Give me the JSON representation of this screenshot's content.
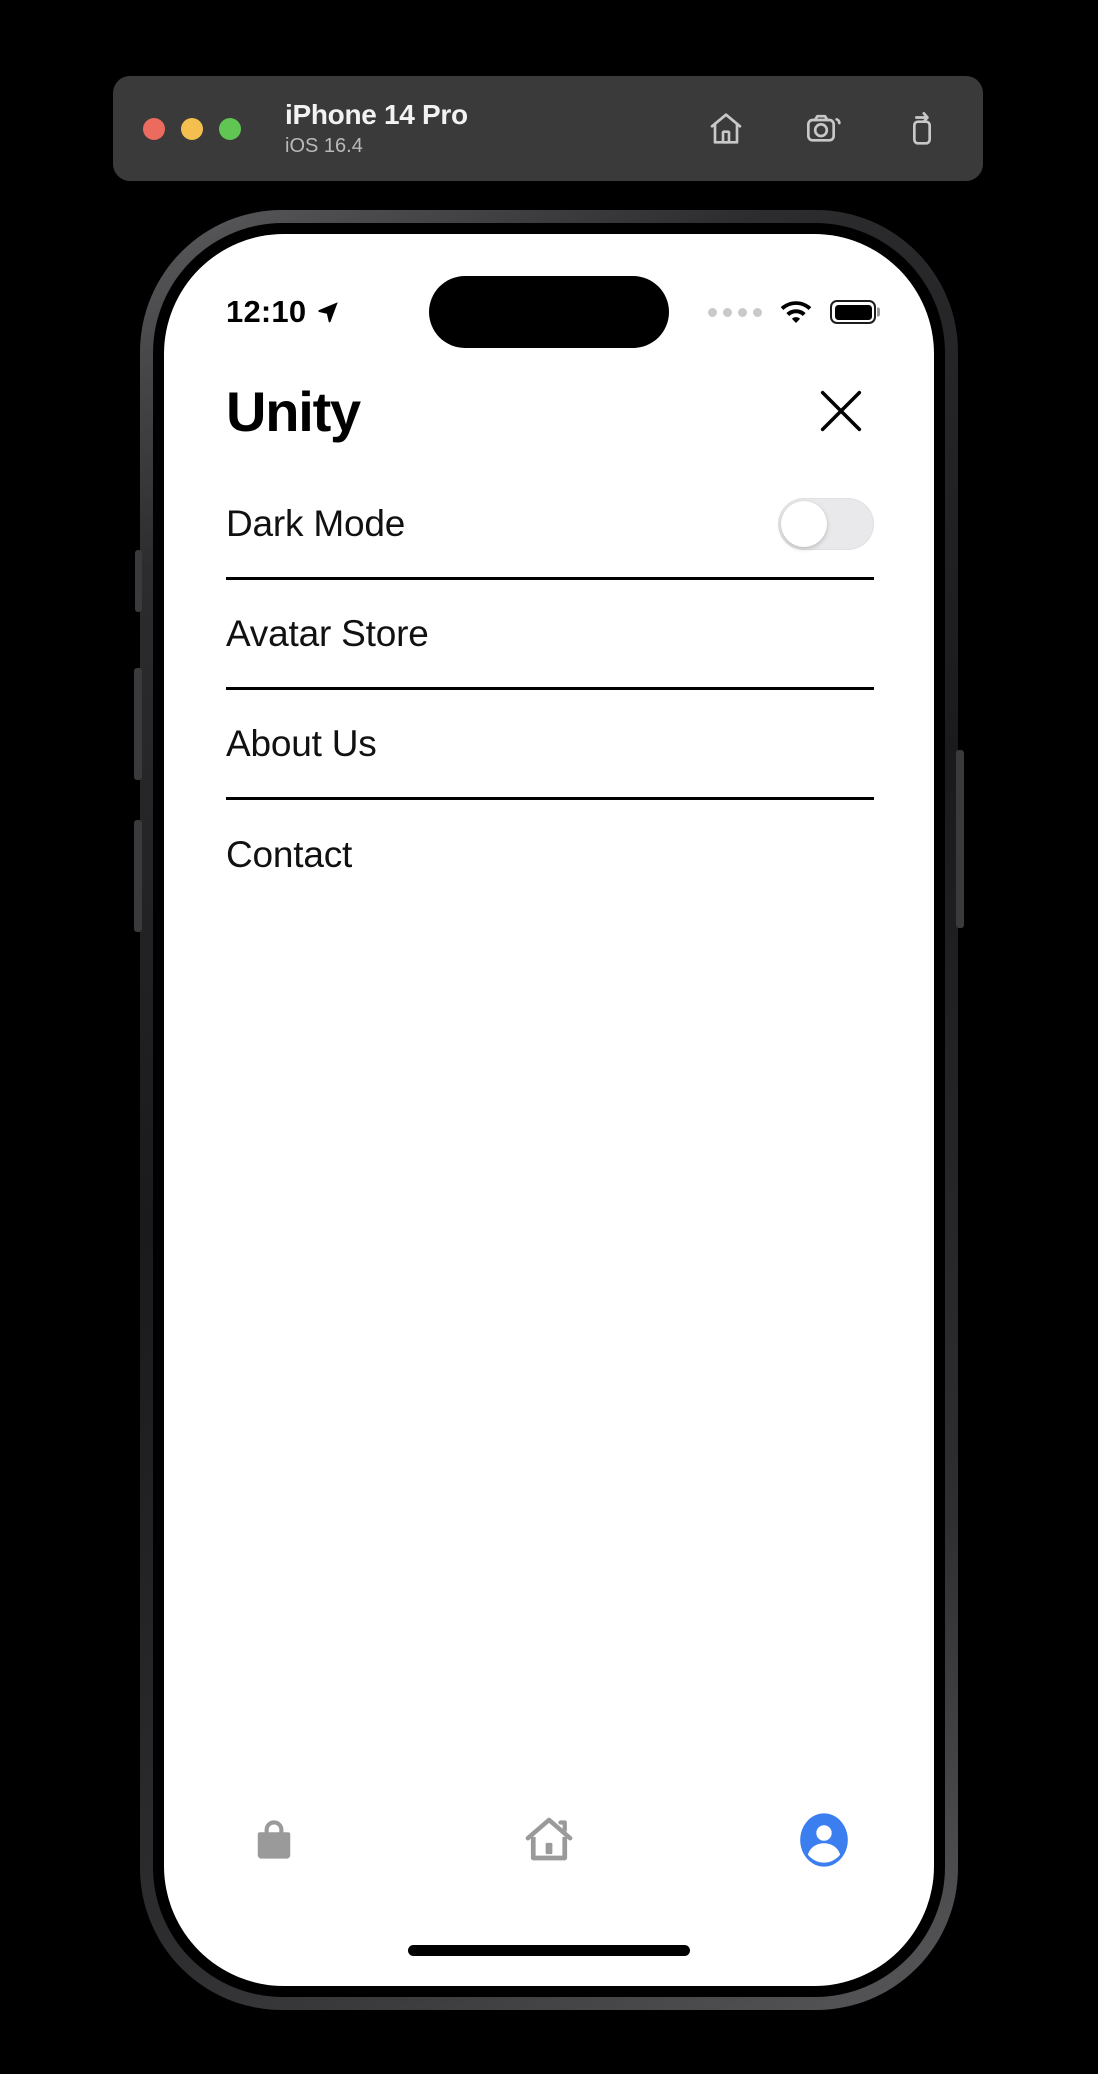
{
  "simulator": {
    "window_title": "iPhone 14 Pro",
    "os_version": "iOS 16.4",
    "traffic_lights": [
      {
        "name": "close",
        "color": "#ed6a5e"
      },
      {
        "name": "minimize",
        "color": "#f5bf4f"
      },
      {
        "name": "maximize",
        "color": "#61c554"
      }
    ],
    "actions": [
      {
        "name": "home-icon",
        "label": "Home"
      },
      {
        "name": "screenshot-icon",
        "label": "Screenshot"
      },
      {
        "name": "rotate-device-icon",
        "label": "Rotate"
      }
    ]
  },
  "status_bar": {
    "time": "12:10",
    "location_icon": "location-arrow-icon",
    "cellular_dots": 4,
    "wifi_icon": "wifi-icon",
    "battery_icon": "battery-full-icon"
  },
  "app": {
    "title": "Unity",
    "close_icon": "close-icon",
    "menu": [
      {
        "label": "Dark Mode",
        "type": "toggle",
        "value": "off"
      },
      {
        "label": "Avatar Store",
        "type": "link"
      },
      {
        "label": "About Us",
        "type": "link"
      },
      {
        "label": "Contact",
        "type": "link"
      }
    ],
    "tabs": [
      {
        "name": "tab-store",
        "icon": "shopping-bag-icon",
        "active": false,
        "color": "#9a9a9a"
      },
      {
        "name": "tab-home",
        "icon": "house-icon",
        "active": false,
        "color": "#9a9a9a"
      },
      {
        "name": "tab-profile",
        "icon": "person-circle-icon",
        "active": true,
        "color": "#3b7ef0"
      }
    ]
  },
  "colors": {
    "accent": "#3b7ef0",
    "inactive": "#9a9a9a",
    "divider": "#000000",
    "toggle_off_track": "#e9e9eb"
  }
}
